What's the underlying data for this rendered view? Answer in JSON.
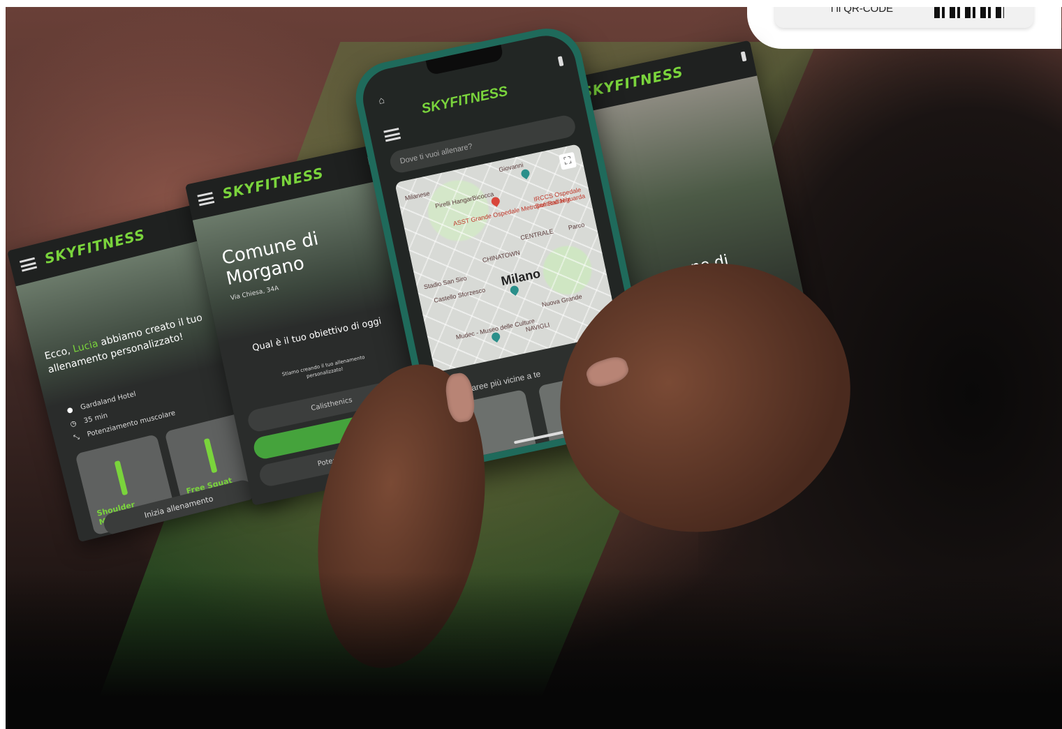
{
  "qr": {
    "text": "i il QR-CODE"
  },
  "screen1": {
    "logo": "SKYFITNESS",
    "greeting_prefix": "Ecco,",
    "user_name": "Lucia",
    "greeting_rest": "abbiamo creato il tuo allenamento personalizzato!",
    "location": "Gardaland Hotel",
    "duration": "35 min",
    "goal": "Potenziamento muscolare",
    "tiles": [
      "Shoulder Machine CP",
      "Free Squat Machine CP"
    ],
    "start_button": "Inizia allenamento"
  },
  "screen2": {
    "logo": "SKYFITNESS",
    "city": "Comune di Morgano",
    "address": "Via Chiesa, 34A",
    "question": "Qual è il tuo obiettivo di oggi",
    "subtext": "Stiamo creando il tuo allenamento personalizzato!",
    "options": [
      "Calisthenics",
      "",
      "Potenziamento"
    ],
    "bottom_partial": "Qu"
  },
  "phone": {
    "logo": "SKYFITNESS",
    "search_placeholder": "Dove ti vuoi allenare?",
    "map": {
      "city": "Milano",
      "labels": [
        "Giovanni",
        "Pirelli HangarBicocca",
        "ASST Grande Ospedale Metropolitano Niguarda",
        "IRCCS Ospedale San Raffaele",
        "Stadio San Siro",
        "Castello Sforzesco",
        "CHINATOWN",
        "CENTRALE",
        "Mudec - Museo delle Culture",
        "NAVIGLI",
        "Milanese",
        "Parco",
        "Nuova Grande"
      ]
    },
    "sheet_title": "Le aree più vicine a te"
  },
  "screen4": {
    "logo": "SKYFITNESS",
    "partial_title": "ne di"
  }
}
